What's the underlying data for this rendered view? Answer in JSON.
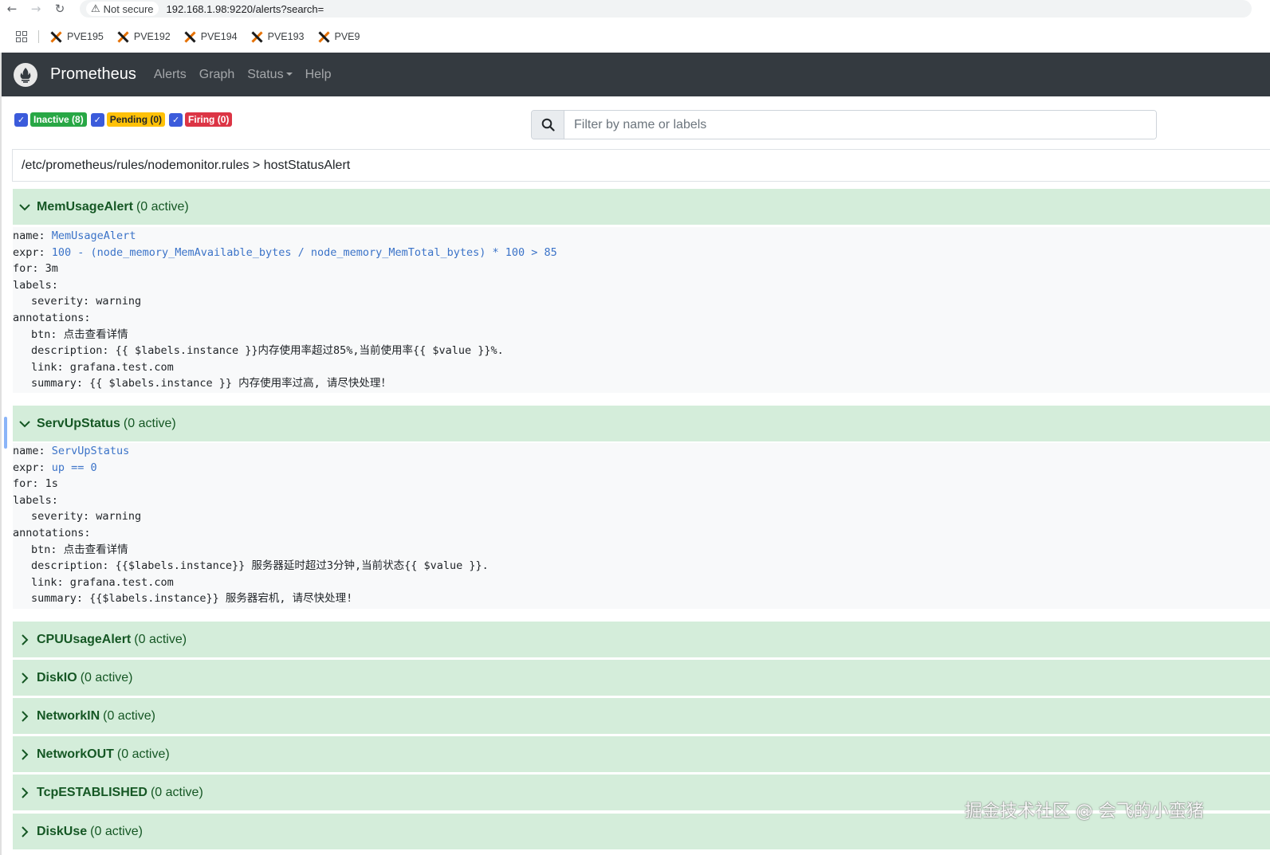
{
  "browser": {
    "security_label": "Not secure",
    "url": "192.168.1.98:9220/alerts?search=",
    "bookmarks": [
      "PVE195",
      "PVE192",
      "PVE194",
      "PVE193",
      "PVE9"
    ]
  },
  "navbar": {
    "brand": "Prometheus",
    "links": [
      "Alerts",
      "Graph",
      "Status",
      "Help"
    ]
  },
  "filters": {
    "inactive": "Inactive (8)",
    "pending": "Pending (0)",
    "firing": "Firing (0)"
  },
  "search": {
    "placeholder": "Filter by name or labels",
    "value": ""
  },
  "group": {
    "title": "/etc/prometheus/rules/nodemonitor.rules > hostStatusAlert"
  },
  "rules": [
    {
      "name": "MemUsageAlert",
      "count": "(0 active)",
      "expanded": true,
      "details": {
        "name_key": "name:",
        "name_val": "MemUsageAlert",
        "expr_key": "expr:",
        "expr_val": "100 - (node_memory_MemAvailable_bytes / node_memory_MemTotal_bytes) * 100 > 85",
        "for": "for: 3m",
        "labels": "labels:",
        "severity": "severity: warning",
        "annotations": "annotations:",
        "btn": "btn: 点击查看详情",
        "description": "description: {{ $labels.instance }}内存使用率超过85%,当前使用率{{ $value }}%.",
        "link": "link: grafana.test.com",
        "summary": "summary: {{ $labels.instance }} 内存使用率过高, 请尽快处理！"
      }
    },
    {
      "name": "ServUpStatus",
      "count": "(0 active)",
      "expanded": true,
      "details": {
        "name_key": "name:",
        "name_val": "ServUpStatus",
        "expr_key": "expr:",
        "expr_val": "up == 0",
        "for": "for: 1s",
        "labels": "labels:",
        "severity": "severity: warning",
        "annotations": "annotations:",
        "btn": "btn: 点击查看详情",
        "description": "description: {{$labels.instance}} 服务器延时超过3分钟,当前状态{{ $value }}.",
        "link": "link: grafana.test.com",
        "summary": "summary: {{$labels.instance}} 服务器宕机, 请尽快处理!"
      }
    },
    {
      "name": "CPUUsageAlert",
      "count": "(0 active)",
      "expanded": false
    },
    {
      "name": "DiskIO",
      "count": "(0 active)",
      "expanded": false
    },
    {
      "name": "NetworkIN",
      "count": "(0 active)",
      "expanded": false
    },
    {
      "name": "NetworkOUT",
      "count": "(0 active)",
      "expanded": false
    },
    {
      "name": "TcpESTABLISHED",
      "count": "(0 active)",
      "expanded": false
    },
    {
      "name": "DiskUse",
      "count": "(0 active)",
      "expanded": false
    }
  ],
  "watermark": "掘金技术社区 @ 会飞的小蛮猪"
}
